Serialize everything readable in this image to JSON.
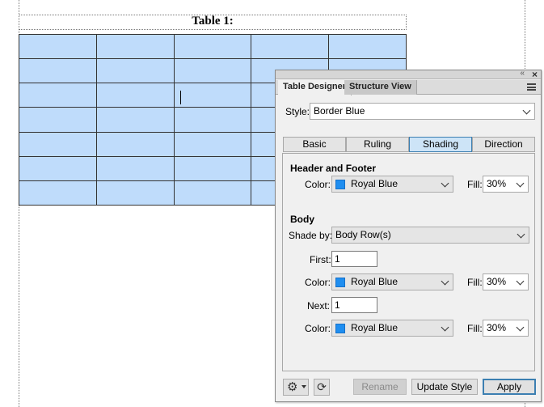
{
  "document": {
    "table_title": "Table 1:",
    "table": {
      "rows": 7,
      "columns": 5,
      "fill_color": "#bfdcfb"
    }
  },
  "panel": {
    "tabs": [
      {
        "label": "Table Designer",
        "active": true
      },
      {
        "label": "Structure View",
        "active": false
      }
    ],
    "titlebar": {
      "collapse_icon": "double-chevron-left-icon",
      "close_icon": "close-icon"
    },
    "style": {
      "label": "Style:",
      "value": "Border Blue"
    },
    "style_tabs": [
      {
        "label": "Basic",
        "selected": false
      },
      {
        "label": "Ruling",
        "selected": false
      },
      {
        "label": "Shading",
        "selected": true
      },
      {
        "label": "Direction",
        "selected": false
      }
    ],
    "header_footer": {
      "heading": "Header and Footer",
      "color_label": "Color:",
      "color_value": "Royal Blue",
      "fill_label": "Fill:",
      "fill_value": "30%"
    },
    "body": {
      "heading": "Body",
      "shade_by_label": "Shade by:",
      "shade_by_value": "Body Row(s)",
      "first_label": "First:",
      "first_value": "1",
      "first_color_label": "Color:",
      "first_color_value": "Royal Blue",
      "first_fill_label": "Fill:",
      "first_fill_value": "30%",
      "next_label": "Next:",
      "next_value": "1",
      "next_color_label": "Color:",
      "next_color_value": "Royal Blue",
      "next_fill_label": "Fill:",
      "next_fill_value": "30%"
    },
    "swatch_color": "#1f8ef0",
    "buttons": {
      "rename": "Rename",
      "update_style": "Update Style",
      "apply": "Apply"
    }
  }
}
